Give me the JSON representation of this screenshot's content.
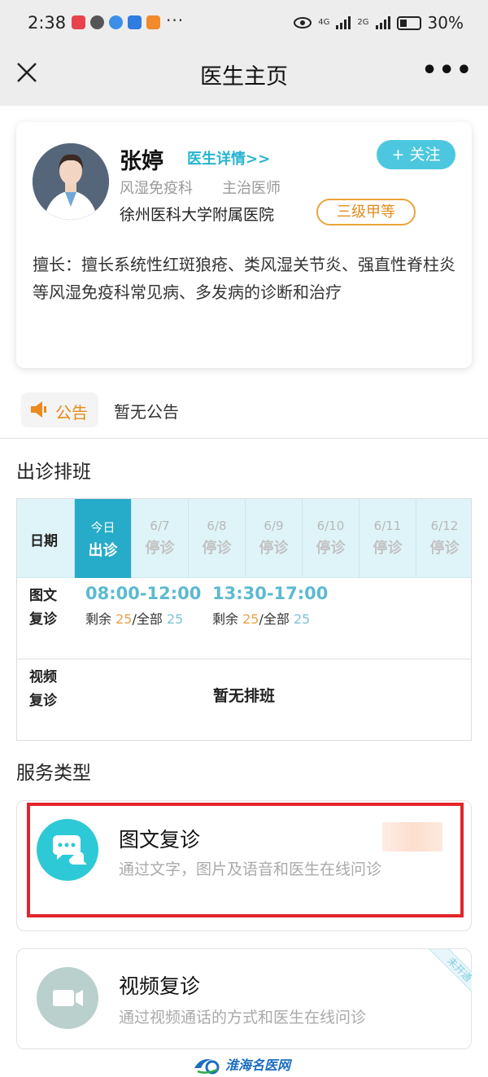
{
  "status_bar": {
    "time": "2:38",
    "dots": "···",
    "network1": "4G",
    "network2": "2G",
    "battery": "30%"
  },
  "nav": {
    "title": "医生主页"
  },
  "doctor": {
    "name": "张婷",
    "detail_link": "医生详情>>",
    "follow_label": "+ 关注",
    "department": "风湿免疫科",
    "title": "主治医师",
    "hospital": "徐州医科大学附属医院",
    "grade": "三级甲等",
    "specialty": "擅长：擅长系统性红斑狼疮、类风湿关节炎、强直性脊柱炎等风湿免疫科常见病、多发病的诊断和治疗"
  },
  "notice": {
    "label": "公告",
    "text": "暂无公告"
  },
  "schedule": {
    "section_title": "出诊排班",
    "date_label": "日期",
    "days": [
      {
        "date": "今日",
        "status": "出诊"
      },
      {
        "date": "6/7",
        "status": "停诊"
      },
      {
        "date": "6/8",
        "status": "停诊"
      },
      {
        "date": "6/9",
        "status": "停诊"
      },
      {
        "date": "6/10",
        "status": "停诊"
      },
      {
        "date": "6/11",
        "status": "停诊"
      },
      {
        "date": "6/12",
        "status": "停诊"
      }
    ],
    "rows": [
      {
        "label_line1": "图文",
        "label_line2": "复诊",
        "slots": [
          {
            "time": "08:00-12:00",
            "remain_label": "剩余 ",
            "remain": "25",
            "total_label": "/全部 ",
            "total": "25"
          },
          {
            "time": "13:30-17:00",
            "remain_label": "剩余 ",
            "remain": "25",
            "total_label": "/全部 ",
            "total": "25"
          }
        ]
      },
      {
        "label_line1": "视频",
        "label_line2": "复诊",
        "empty_text": "暂无排班"
      }
    ]
  },
  "services": {
    "section_title": "服务类型",
    "items": [
      {
        "title": "图文复诊",
        "desc": "通过文字，图片及语音和医生在线问诊",
        "icon": "chat-bubbles-icon",
        "color": "#2ec9d6"
      },
      {
        "title": "视频复诊",
        "desc": "通过视频通话的方式和医生在线问诊",
        "icon": "video-camera-icon",
        "color": "#b9d0cc",
        "ribbon": "未开通"
      }
    ]
  },
  "footer": {
    "logo_text": "淮海名医网"
  }
}
